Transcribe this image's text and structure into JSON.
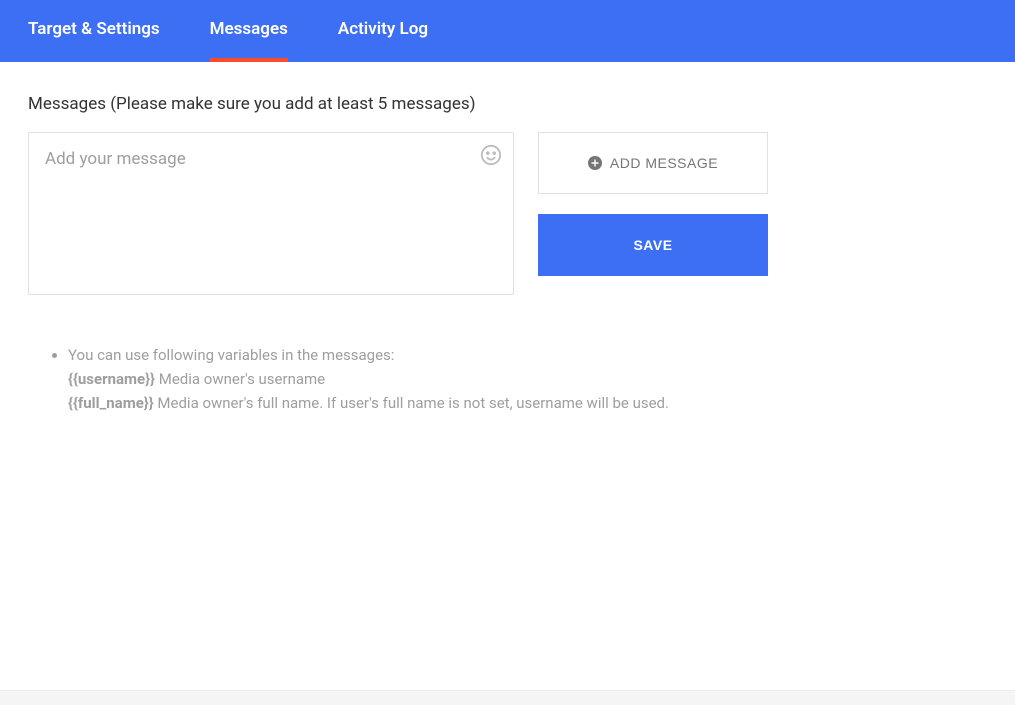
{
  "tabs": {
    "target_settings": "Target & Settings",
    "messages": "Messages",
    "activity_log": "Activity Log"
  },
  "section_title": "Messages (Please make sure you add at least 5 messages)",
  "message_input": {
    "placeholder": "Add your message",
    "value": ""
  },
  "buttons": {
    "add_message": "ADD MESSAGE",
    "save": "SAVE"
  },
  "help": {
    "intro": "You can use following variables in the messages:",
    "var1_name": "{{username}}",
    "var1_desc": " Media owner's username",
    "var2_name": "{{full_name}}",
    "var2_desc": " Media owner's full name. If user's full name is not set, username will be used."
  }
}
